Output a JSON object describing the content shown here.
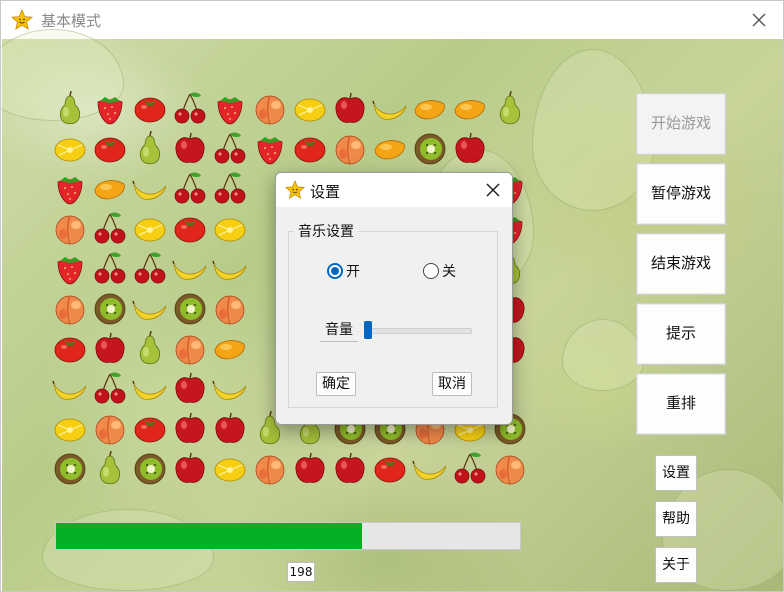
{
  "window": {
    "title": "基本模式",
    "title_icon": "star-smiley-icon",
    "close_icon": "close-icon"
  },
  "game": {
    "fruit_rows": [
      [
        "pear",
        "strawberry",
        "tomato",
        "cherry",
        "strawberry",
        "peach",
        "lemon",
        "apple",
        "banana",
        "mango",
        "mango",
        "pear"
      ],
      [
        "lemon",
        "tomato",
        "pear",
        "apple",
        "cherry",
        "strawberry",
        "tomato",
        "peach",
        "mango",
        "kiwi",
        "apple"
      ],
      [
        "strawberry",
        "mango",
        "banana",
        "cherry",
        "cherry"
      ],
      [
        "peach",
        "cherry",
        "lemon",
        "tomato",
        "lemon"
      ],
      [
        "strawberry",
        "cherry",
        "cherry",
        "banana",
        "banana"
      ],
      [
        "peach",
        "kiwi",
        "banana",
        "kiwi",
        "peach"
      ],
      [
        "tomato",
        "apple",
        "pear",
        "peach",
        "mango"
      ],
      [
        "banana",
        "cherry",
        "banana",
        "apple",
        "banana"
      ],
      [
        "lemon",
        "peach",
        "tomato",
        "apple",
        "apple",
        "pear",
        "pear",
        "kiwi",
        "kiwi",
        "peach",
        "lemon",
        "kiwi"
      ],
      [
        "kiwi",
        "pear",
        "kiwi",
        "apple",
        "lemon",
        "peach",
        "apple",
        "apple",
        "tomato",
        "banana",
        "cherry",
        "peach"
      ]
    ],
    "right_edge_fruits": [
      "strawberry",
      "strawberry",
      "pear",
      "apple",
      "apple"
    ]
  },
  "side_buttons": {
    "start": "开始游戏",
    "pause": "暂停游戏",
    "end": "结束游戏",
    "hint": "提示",
    "reshuffle": "重排"
  },
  "small_buttons": {
    "settings": "设置",
    "help": "帮助",
    "about": "关于"
  },
  "progress": {
    "fraction": 0.66,
    "color": "#06b025",
    "counter": "198"
  },
  "dialog": {
    "title": "设置",
    "title_icon": "star-smiley-icon",
    "close_icon": "close-icon",
    "group_label": "音乐设置",
    "radio_on_label": "开",
    "radio_off_label": "关",
    "selected": "开",
    "volume_label": "音量",
    "volume_fraction": 0.0,
    "ok_label": "确定",
    "cancel_label": "取消",
    "accent_color": "#0067c0"
  }
}
